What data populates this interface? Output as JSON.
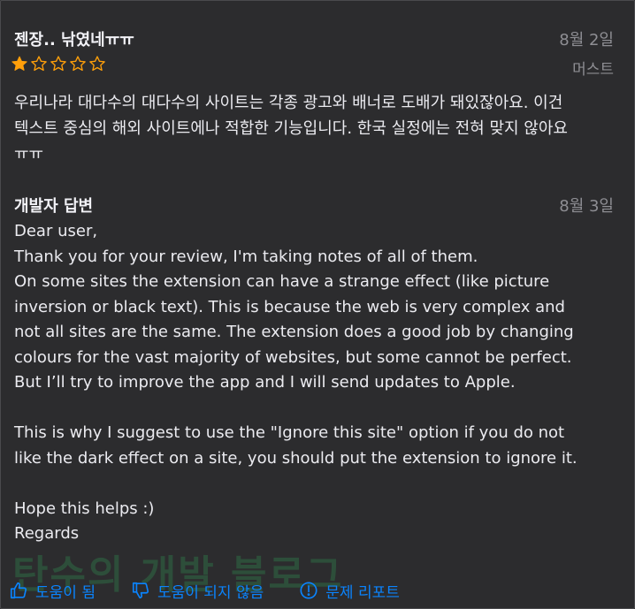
{
  "review": {
    "title": "젠장.. 낚였네ㅠㅠ",
    "date": "8월 2일",
    "author": "머스트",
    "rating": 1,
    "max_rating": 5,
    "body": "우리나라 대다수의 대다수의 사이트는 각종 광고와 배너로 도배가 돼있잖아요. 이건\n텍스트 중심의 해외 사이트에나 적합한 기능입니다. 한국 실정에는 전혀 맞지 않아요\nㅠㅠ"
  },
  "developer_response": {
    "title": "개발자 답변",
    "date": "8월 3일",
    "body": "Dear user,\nThank you for your review, I'm taking notes of all of them.\nOn some sites the extension can have a strange effect (like picture\ninversion or black text). This is because the web is very complex and\nnot all sites are the same. The extension does a good job by changing\ncolours for the vast majority of websites, but some cannot be perfect.\nBut I’ll try to improve the app and I will send updates to Apple.\n\nThis is why I suggest to use the \"Ignore this site\" option if you do not\nlike the dark effect on a site, you should put the extension to ignore it.\n\nHope this helps :)\nRegards"
  },
  "watermark": "탄수의 개발 블로그",
  "actions": {
    "helpful": "도움이 됨",
    "not_helpful": "도움이 되지 않음",
    "report": "문제 리포트"
  },
  "colors": {
    "background": "#2c2c2e",
    "accent": "#0a84ff",
    "star": "#ff9f0a",
    "secondary_text": "#8e8e93"
  }
}
